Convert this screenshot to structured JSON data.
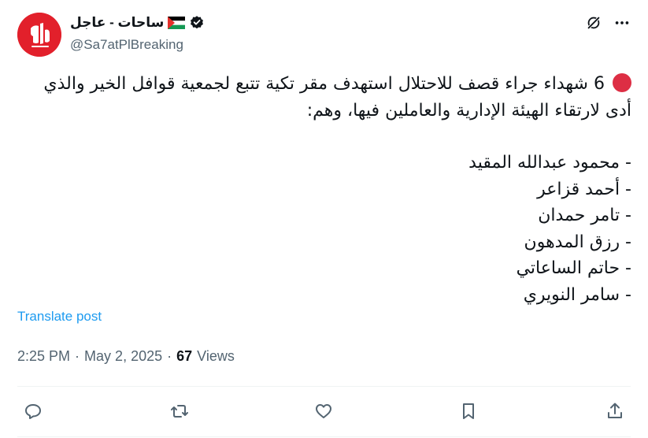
{
  "author": {
    "name": "ساحات - عاجل",
    "handle": "@Sa7atPlBreaking",
    "avatar_icon": "sahat-logo-icon",
    "flag_icon": "palestine-flag-icon",
    "verified_icon": "verified-badge-icon",
    "brand_color": "#e2202b"
  },
  "header_actions": {
    "grok_icon": "grok-icon",
    "more_icon": "more-dots-icon"
  },
  "post": {
    "lines": [
      "6 شهداء جراء قصف للاحتلال استهدف مقر تكية تتبع لجمعية قوافل الخير والذي",
      "أدى لارتقاء الهيئة الإدارية والعاملين فيها، وهم:",
      "",
      "- محمود عبدالله المقيد",
      "- أحمد قزاعر",
      "- تامر حمدان",
      "- رزق المدهون",
      "- حاتم الساعاتي",
      "- سامر النويري"
    ],
    "lead_icon": "red-circle-icon",
    "translate_label": "Translate post"
  },
  "meta": {
    "time": "2:25 PM",
    "separator": "·",
    "date": "May 2, 2025",
    "views_count": "67",
    "views_label": "Views"
  },
  "action_bar": {
    "reply_icon": "reply-icon",
    "repost_icon": "repost-icon",
    "like_icon": "like-icon",
    "bookmark_icon": "bookmark-icon",
    "share_icon": "share-icon",
    "icon_color": "#536471"
  }
}
